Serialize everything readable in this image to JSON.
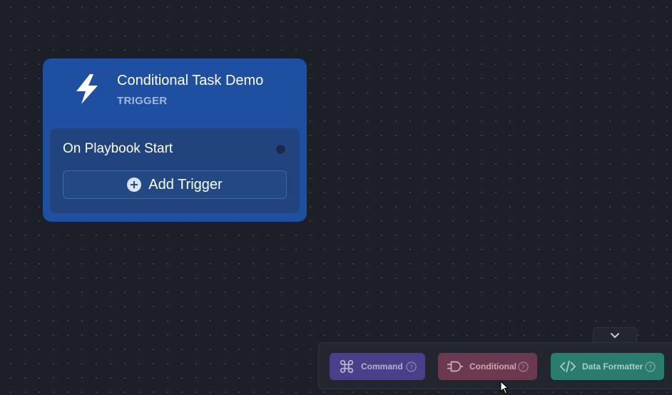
{
  "node": {
    "title": "Conditional Task Demo",
    "subtitle": "TRIGGER",
    "icon": "lightning-bolt-icon",
    "trigger_label": "On Playbook Start",
    "add_trigger_label": "Add Trigger"
  },
  "toolbar": {
    "collapse_icon": "chevron-down-icon",
    "tools": [
      {
        "label": "Command",
        "icon": "command-key-icon",
        "color": "#4a3f8a"
      },
      {
        "label": "Conditional",
        "icon": "logic-gate-icon",
        "color": "#6b3a4f"
      },
      {
        "label": "Data Formatter",
        "icon": "code-brackets-icon",
        "color": "#2a7c6e"
      }
    ]
  },
  "colors": {
    "canvas_background": "#1c1f28",
    "node_background": "#1f4fa0",
    "node_body": "#21447f"
  }
}
